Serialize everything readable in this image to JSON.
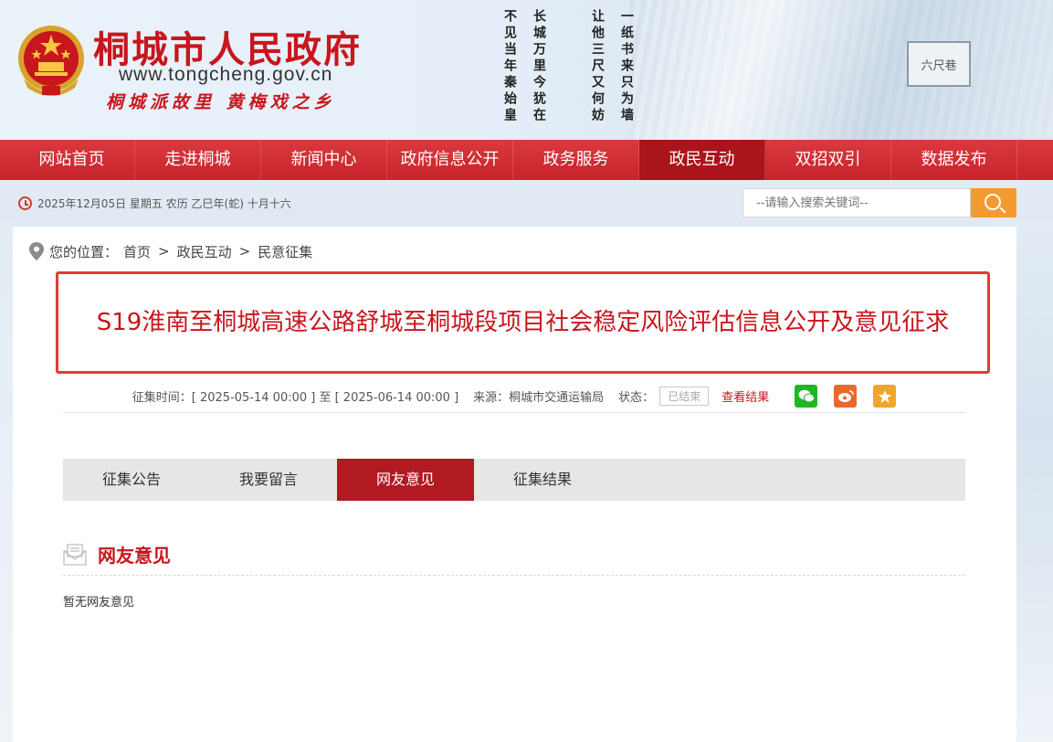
{
  "header": {
    "site_title": "桐城市人民政府",
    "site_url": "www.tongcheng.gov.cn",
    "slogan": "桐城派故里  黄梅戏之乡",
    "poem_columns": [
      "一纸书来只为墙",
      "让他三尺又何妨",
      "长城万里今犹在",
      "不见当年秦始皇"
    ],
    "scenery_sign": "六尺巷"
  },
  "nav": {
    "items": [
      "网站首页",
      "走进桐城",
      "新闻中心",
      "政府信息公开",
      "政务服务",
      "政民互动",
      "双招双引",
      "数据发布"
    ],
    "active_index": 5
  },
  "datebar": {
    "date_text": "2025年12月05日 星期五 农历 乙巳年(蛇) 十月十六"
  },
  "search": {
    "placeholder": "--请输入搜索关键词--",
    "button_icon": "search-icon"
  },
  "breadcrumb": {
    "label": "您的位置：",
    "items": [
      "首页",
      "政民互动",
      "民意征集"
    ],
    "separator": ">"
  },
  "article": {
    "title": "S19淮南至桐城高速公路舒城至桐城段项目社会稳定风险评估信息公开及意见征求"
  },
  "meta": {
    "time_label": "征集时间：[ 2025-05-14 00:00 ] 至 [ 2025-06-14 00:00 ]",
    "source": "来源：桐城市交通运输局",
    "status_label": "状态：",
    "status_value": "已结束",
    "result_link": "查看结果",
    "share_icons": [
      "wechat-icon",
      "weibo-icon",
      "favorite-icon"
    ]
  },
  "tabs": {
    "items": [
      "征集公告",
      "我要留言",
      "网友意见",
      "征集结果"
    ],
    "active_index": 2
  },
  "section": {
    "title": "网友意见",
    "empty_text": "暂无网友意见"
  },
  "colors": {
    "brand_red": "#c8161d",
    "nav_red": "#c8232a",
    "search_orange": "#f39b2f"
  }
}
